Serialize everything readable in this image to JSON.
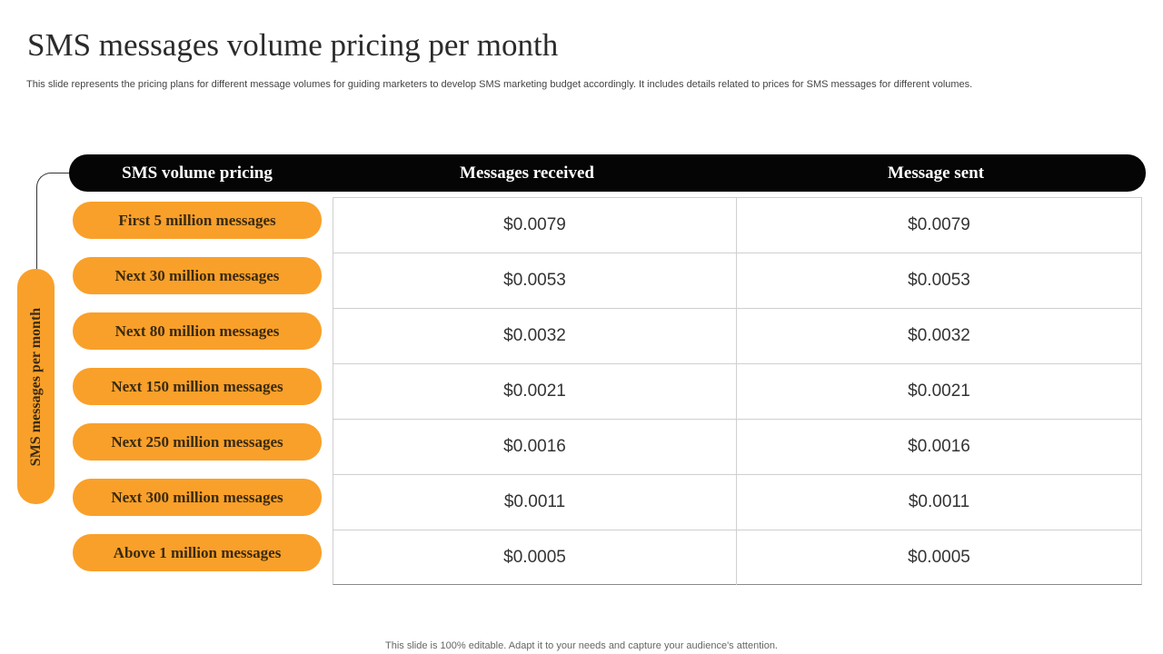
{
  "slide": {
    "title": "SMS messages volume pricing per month",
    "subtitle": "This slide represents the pricing plans for different message volumes for guiding marketers to develop SMS  marketing budget accordingly. It includes details related to prices for SMS  messages for different volumes.",
    "footer": "This slide is 100% editable. Adapt it to your needs and capture your audience's attention."
  },
  "side_label": "SMS messages per month",
  "table": {
    "headers": [
      "SMS volume pricing",
      "Messages received",
      "Message sent"
    ],
    "rows": [
      {
        "tier": "First 5 million messages",
        "received": "$0.0079",
        "sent": "$0.0079"
      },
      {
        "tier": "Next 30 million messages",
        "received": "$0.0053",
        "sent": "$0.0053"
      },
      {
        "tier": "Next 80 million messages",
        "received": "$0.0032",
        "sent": "$0.0032"
      },
      {
        "tier": "Next 150 million messages",
        "received": "$0.0021",
        "sent": "$0.0021"
      },
      {
        "tier": "Next 250 million messages",
        "received": "$0.0016",
        "sent": "$0.0016"
      },
      {
        "tier": "Next 300 million messages",
        "received": "$0.0011",
        "sent": "$0.0011"
      },
      {
        "tier": "Above  1 million messages",
        "received": "$0.0005",
        "sent": "$0.0005"
      }
    ]
  },
  "colors": {
    "accent": "#f9a02a",
    "header_bg": "#050505"
  }
}
